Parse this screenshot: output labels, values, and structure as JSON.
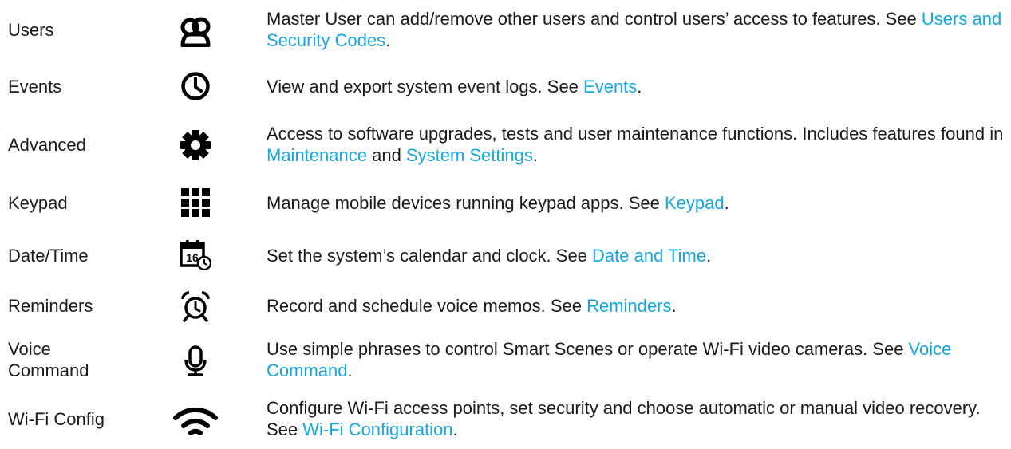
{
  "accent_link_color": "#14a7e0",
  "rows": [
    {
      "name": "Users",
      "icon": "users-icon",
      "text_before": "Master User can add/remove other users and control users’ access to features. See ",
      "link1": "Users and Security Codes",
      "text_mid": "",
      "link2": "",
      "text_after": "."
    },
    {
      "name": "Events",
      "icon": "clock-icon",
      "text_before": "View and export system event logs. See ",
      "link1": "Events",
      "text_mid": "",
      "link2": "",
      "text_after": "."
    },
    {
      "name": "Advanced",
      "icon": "gear-icon",
      "text_before": "Access to software upgrades, tests and user maintenance functions. Includes features found in ",
      "link1": "Maintenance",
      "text_mid": " and ",
      "link2": "System Settings",
      "text_after": "."
    },
    {
      "name": "Keypad",
      "icon": "keypad-grid-icon",
      "text_before": "Manage mobile devices running keypad apps. See ",
      "link1": "Keypad",
      "text_mid": "",
      "link2": "",
      "text_after": "."
    },
    {
      "name": "Date/Time",
      "icon": "calendar-clock-icon",
      "icon_text": "16",
      "text_before": "Set the system’s calendar and clock. See ",
      "link1": "Date and Time",
      "text_mid": "",
      "link2": "",
      "text_after": "."
    },
    {
      "name": "Reminders",
      "icon": "alarm-clock-icon",
      "text_before": "Record and schedule voice memos. See ",
      "link1": "Reminders",
      "text_mid": "",
      "link2": "",
      "text_after": "."
    },
    {
      "name": "Voice Command",
      "icon": "microphone-icon",
      "text_before": "Use simple phrases to control Smart Scenes or operate Wi-Fi video cameras. See ",
      "link1": "Voice Command",
      "text_mid": "",
      "link2": "",
      "text_after": "."
    },
    {
      "name": "Wi-Fi Config",
      "icon": "wifi-icon",
      "text_before": "Configure Wi-Fi access points, set security and choose automatic or manual video recovery. See ",
      "link1": "Wi-Fi Configuration",
      "text_mid": "",
      "link2": "",
      "text_after": "."
    }
  ]
}
